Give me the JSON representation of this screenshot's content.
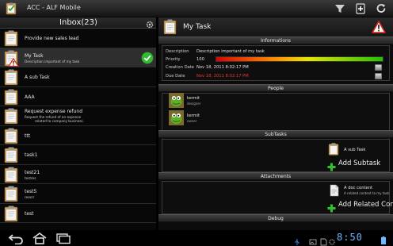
{
  "app": {
    "title": "ACC - ALF Mobile",
    "accent_color": "#33b5e5",
    "toolbar_icons": [
      "filter-icon",
      "add-icon",
      "refresh-icon"
    ]
  },
  "inbox": {
    "title": "Inbox(23)",
    "items": [
      {
        "title": "Provide new sales lead",
        "desc": "",
        "desc2": "",
        "icon": "clipboard-icon",
        "selected": false
      },
      {
        "title": "My Task",
        "desc": "Description important of my task",
        "desc2": "",
        "icon": "clipboard-warning-icon",
        "selected": true
      },
      {
        "title": "A sub Task",
        "desc": "",
        "desc2": "",
        "icon": "clipboard-icon",
        "selected": false
      },
      {
        "title": "AAA",
        "desc": "",
        "desc2": "",
        "icon": "clipboard-icon",
        "selected": false
      },
      {
        "title": "Request expense refund",
        "desc": "Request the refund of an expense",
        "desc2": "related to company business.",
        "icon": "clipboard-icon",
        "selected": false
      },
      {
        "title": "ttt",
        "desc": "",
        "desc2": "",
        "icon": "clipboard-icon",
        "selected": false
      },
      {
        "title": "task1",
        "desc": "",
        "desc2": "",
        "icon": "clipboard-icon",
        "selected": false
      },
      {
        "title": "test21",
        "desc": "testres",
        "desc2": "",
        "icon": "clipboard-icon",
        "selected": false
      },
      {
        "title": "test5",
        "desc": "reesrr",
        "desc2": "",
        "icon": "clipboard-icon",
        "selected": false
      },
      {
        "title": "test",
        "desc": "",
        "desc2": "",
        "icon": "clipboard-icon",
        "selected": false
      }
    ]
  },
  "task": {
    "title": "My Task",
    "informations": {
      "header": "Informations",
      "description_label": "Description",
      "description_value": "Description important of my task",
      "priority_label": "Priority",
      "priority_value": "100",
      "creation_label": "Creation Date",
      "creation_value": "Nov 18, 2011 8:02:17 PM",
      "due_label": "Due Date",
      "due_value": "Nov 18, 2011 8:02:17 PM"
    },
    "people": {
      "header": "People",
      "list": [
        {
          "name": "kermit",
          "role": "designer"
        },
        {
          "name": "kermit",
          "role": "owner"
        }
      ]
    },
    "subtasks": {
      "header": "SubTasks",
      "items": [
        {
          "title": "A sub Task"
        }
      ],
      "add_label": "Add Subtask"
    },
    "attachments": {
      "header": "Attachments",
      "items": [
        {
          "title": "A doc content",
          "desc": "A related content to my task"
        }
      ],
      "add_label": "Add Related Content"
    },
    "debug": {
      "header": "Debug"
    }
  },
  "system": {
    "clock": "8:50",
    "nav_icons": [
      "back-icon",
      "home-icon",
      "recent-apps-icon"
    ],
    "status_icons": [
      "usb-icon",
      "gallery-icon",
      "sd-icon",
      "settings-status-icon",
      "battery-icon"
    ]
  }
}
